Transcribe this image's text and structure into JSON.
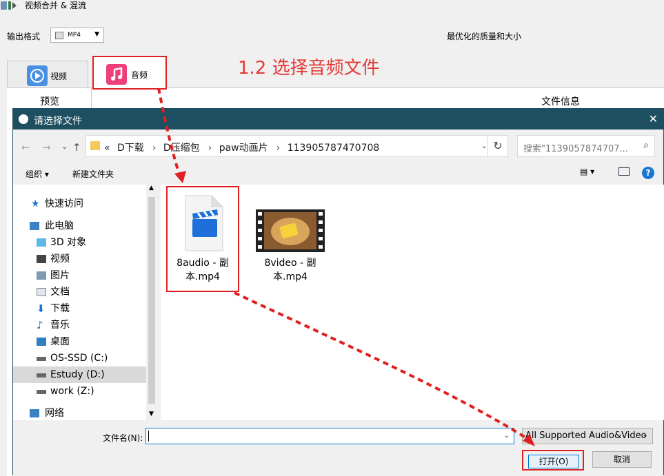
{
  "app": {
    "title": "视频合并 & 混流",
    "output_format_label": "输出格式",
    "output_format_value": "MP4",
    "quality_text": "最优化的质量和大小",
    "annotation": "1.2 选择音频文件",
    "tabs": [
      {
        "label": "视频"
      },
      {
        "label": "音频"
      }
    ],
    "preview_header": "预览",
    "file_info_header": "文件信息"
  },
  "dialog": {
    "title": "请选择文件",
    "close_label": "✕",
    "breadcrumb_overflow": "«",
    "breadcrumbs": [
      "D下载",
      "D压缩包",
      "paw动画片",
      "113905787470708"
    ],
    "search_placeholder": "搜索\"1139057874707...",
    "organize_label": "组织 ▾",
    "new_folder_label": "新建文件夹",
    "help_label": "?",
    "nav_items": [
      {
        "label": "快速访问",
        "icon": "star-icon"
      },
      {
        "label": "此电脑",
        "icon": "computer-icon"
      },
      {
        "label": "3D 对象",
        "icon": "cube-icon"
      },
      {
        "label": "视频",
        "icon": "film-icon"
      },
      {
        "label": "图片",
        "icon": "picture-icon"
      },
      {
        "label": "文档",
        "icon": "document-icon"
      },
      {
        "label": "下载",
        "icon": "download-icon"
      },
      {
        "label": "音乐",
        "icon": "music-icon"
      },
      {
        "label": "桌面",
        "icon": "desktop-icon"
      },
      {
        "label": "OS-SSD (C:)",
        "icon": "drive-icon"
      },
      {
        "label": "Estudy (D:)",
        "icon": "drive-icon"
      },
      {
        "label": "work (Z:)",
        "icon": "drive-icon"
      },
      {
        "label": "网络",
        "icon": "network-icon"
      }
    ],
    "files": [
      {
        "name_line1": "8audio - 副",
        "name_line2": "本.mp4"
      },
      {
        "name_line1": "8video - 副",
        "name_line2": "本.mp4"
      }
    ],
    "filename_label": "文件名(N):",
    "filename_value": "",
    "filetype_value": "All Supported Audio&Video",
    "open_label": "打开(O)",
    "cancel_label": "取消"
  },
  "colors": {
    "accent_red": "#e02020",
    "titlebar": "#1d4f60",
    "link_blue": "#0078d7"
  }
}
